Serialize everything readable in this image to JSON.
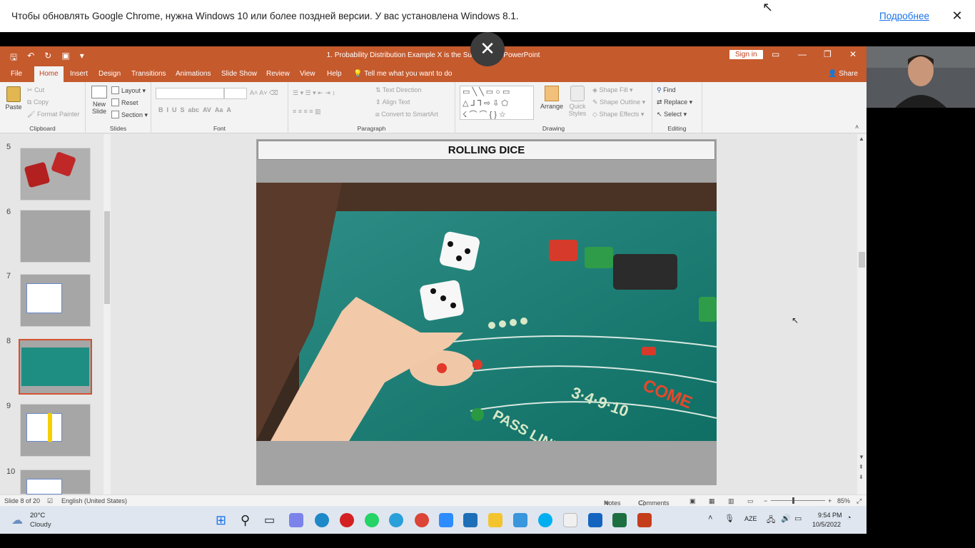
{
  "banner": {
    "message": "Чтобы обновлять Google Chrome, нужна Windows 10 или более поздней версии. У вас установлена Windows 8.1.",
    "more_link": "Подробнее",
    "close_glyph": "✕"
  },
  "overlay_close_glyph": "✕",
  "titlebar": {
    "title": "1. Probability Distribution Example X is the Sum of T... - PowerPoint",
    "signin": "Sign in",
    "accent": "#c55a2d"
  },
  "menubar": {
    "tabs": [
      "File",
      "Home",
      "Insert",
      "Design",
      "Transitions",
      "Animations",
      "Slide Show",
      "Review",
      "View",
      "Help"
    ],
    "tell_me": "Tell me what you want to do",
    "share": "Share"
  },
  "ribbon": {
    "clipboard": {
      "label": "Clipboard",
      "paste": "Paste",
      "cut": "Cut",
      "copy": "Copy",
      "format_painter": "Format Painter"
    },
    "slides": {
      "label": "Slides",
      "new_slide": "New Slide",
      "layout": "Layout",
      "reset": "Reset",
      "section": "Section"
    },
    "font": {
      "label": "Font"
    },
    "paragraph": {
      "label": "Paragraph",
      "text_direction": "Text Direction",
      "align_text": "Align Text",
      "convert": "Convert to SmartArt"
    },
    "drawing": {
      "label": "Drawing",
      "arrange": "Arrange",
      "quick_styles": "Quick Styles",
      "shape_fill": "Shape Fill",
      "shape_outline": "Shape Outline",
      "shape_effects": "Shape Effects"
    },
    "editing": {
      "label": "Editing",
      "find": "Find",
      "replace": "Replace",
      "select": "Select"
    }
  },
  "thumbnails": [
    {
      "num": "5"
    },
    {
      "num": "6"
    },
    {
      "num": "7"
    },
    {
      "num": "8",
      "selected": true
    },
    {
      "num": "9"
    },
    {
      "num": "10"
    }
  ],
  "slide": {
    "title": "ROLLING DICE"
  },
  "status": {
    "slide_of": "Slide 8 of 20",
    "language": "English (United States)",
    "notes": "Notes",
    "comments": "Comments",
    "zoom": "85%"
  },
  "taskbar": {
    "temp": "20°C",
    "weather": "Cloudy",
    "lang": "AZE",
    "time": "9:54 PM",
    "date": "10/5/2022"
  }
}
